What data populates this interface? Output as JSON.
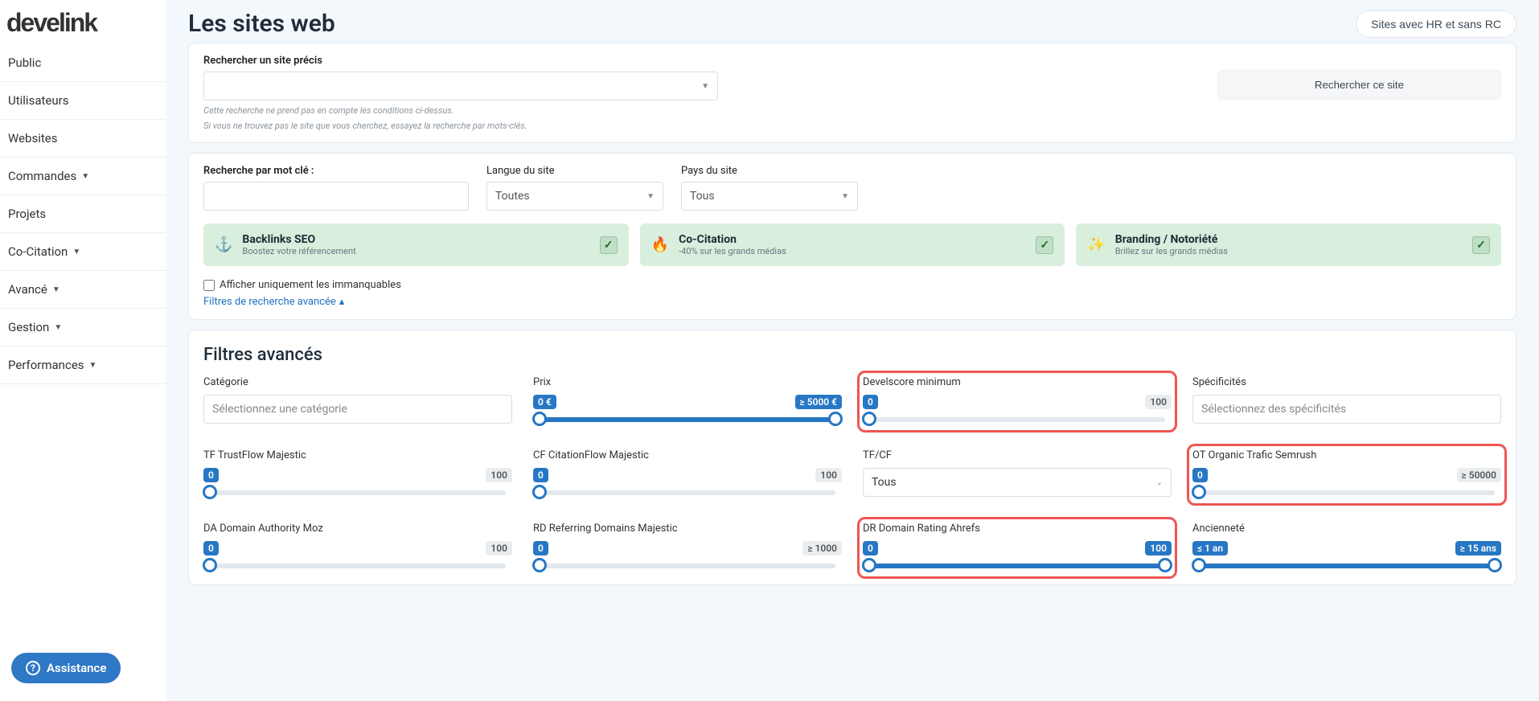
{
  "page": {
    "title": "Les sites web",
    "header_button": "Sites avec HR et sans RC"
  },
  "logo": "develink",
  "nav": {
    "items": [
      {
        "label": "Public",
        "has_caret": false
      },
      {
        "label": "Utilisateurs",
        "has_caret": false
      },
      {
        "label": "Websites",
        "has_caret": false
      },
      {
        "label": "Commandes",
        "has_caret": true
      },
      {
        "label": "Projets",
        "has_caret": false
      },
      {
        "label": "Co-Citation",
        "has_caret": true
      },
      {
        "label": "Avancé",
        "has_caret": true
      },
      {
        "label": "Gestion",
        "has_caret": true
      },
      {
        "label": "Performances",
        "has_caret": true
      }
    ]
  },
  "assistance": "Assistance",
  "search_panel": {
    "label": "Rechercher un site précis",
    "submit": "Rechercher ce site",
    "hint1": "Cette recherche ne prend pas en compte les conditions ci-dessus.",
    "hint2": "Si vous ne trouvez pas le site que vous cherchez, essayez la recherche par mots-clés."
  },
  "filter_panel": {
    "keyword_label": "Recherche par mot clé :",
    "lang_label": "Langue du site",
    "lang_value": "Toutes",
    "country_label": "Pays du site",
    "country_value": "Tous",
    "cards": [
      {
        "icon": "⚓",
        "title": "Backlinks SEO",
        "sub": "Boostez votre référencement"
      },
      {
        "icon": "🔥",
        "title": "Co-Citation",
        "sub": "-40% sur les grands médias"
      },
      {
        "icon": "✨",
        "title": "Branding / Notoriété",
        "sub": "Brillez sur les grands médias"
      }
    ],
    "only_unmissable": "Afficher uniquement les immanquables",
    "advanced_link": "Filtres de recherche avancée"
  },
  "advanced": {
    "title": "Filtres avancés",
    "category": {
      "label": "Catégorie",
      "placeholder": "Sélectionnez une catégorie"
    },
    "price": {
      "label": "Prix",
      "min": "0 €",
      "max": "≥ 5000 €"
    },
    "develscore": {
      "label": "Develscore minimum",
      "min": "0",
      "max": "100"
    },
    "specifics": {
      "label": "Spécificités",
      "placeholder": "Sélectionnez des spécificités"
    },
    "tf": {
      "label": "TF TrustFlow Majestic",
      "min": "0",
      "max": "100"
    },
    "cf": {
      "label": "CF CitationFlow Majestic",
      "min": "0",
      "max": "100"
    },
    "tfcf": {
      "label": "TF/CF",
      "value": "Tous"
    },
    "ot": {
      "label": "OT Organic Trafic Semrush",
      "min": "0",
      "max": "≥ 50000"
    },
    "da": {
      "label": "DA Domain Authority Moz",
      "min": "0",
      "max": "100"
    },
    "rd": {
      "label": "RD Referring Domains Majestic",
      "min": "0",
      "max": "≥ 1000"
    },
    "dr": {
      "label": "DR Domain Rating Ahrefs",
      "min": "0",
      "max": "100"
    },
    "age": {
      "label": "Ancienneté",
      "min": "≤ 1 an",
      "max": "≥ 15 ans"
    }
  }
}
